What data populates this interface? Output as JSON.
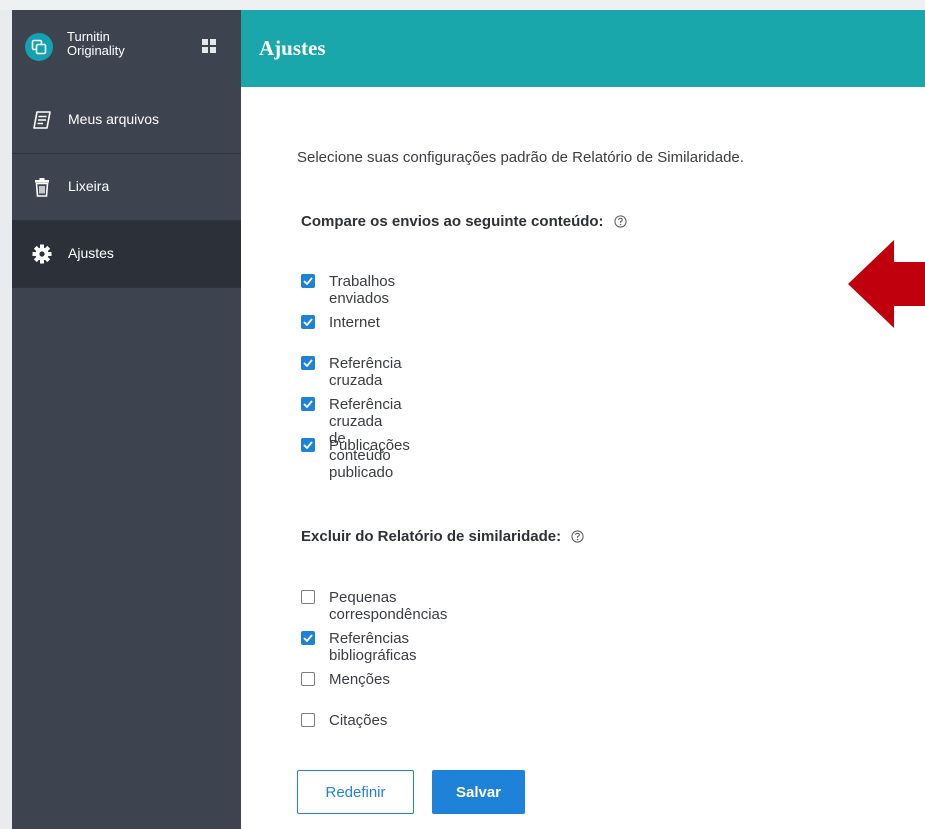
{
  "brand": {
    "line1": "Turnitin",
    "line2": "Originality"
  },
  "sidebar": {
    "items": [
      {
        "label": "Meus arquivos",
        "icon": "file-list-icon"
      },
      {
        "label": "Lixeira",
        "icon": "trash-icon"
      },
      {
        "label": "Ajustes",
        "icon": "gear-icon",
        "active": true
      }
    ]
  },
  "header": {
    "title": "Ajustes"
  },
  "main": {
    "intro": "Selecione suas configurações padrão de Relatório de Similaridade.",
    "compare": {
      "title": "Compare os envios ao seguinte conteúdo:",
      "options": [
        {
          "label": "Trabalhos enviados",
          "checked": true
        },
        {
          "label": "Internet",
          "checked": true
        },
        {
          "label": "Referência cruzada",
          "checked": true
        },
        {
          "label": "Referência cruzada de conteúdo publicado",
          "checked": true
        },
        {
          "label": "Publicações",
          "checked": true
        }
      ]
    },
    "exclude": {
      "title": "Excluir do Relatório de similaridade:",
      "options": [
        {
          "label": "Pequenas correspondências",
          "checked": false
        },
        {
          "label": "Referências bibliográficas",
          "checked": true
        },
        {
          "label": "Menções",
          "checked": false
        },
        {
          "label": "Citações",
          "checked": false
        }
      ]
    },
    "buttons": {
      "reset": "Redefinir",
      "save": "Salvar"
    }
  },
  "colors": {
    "sidebar": "#3e4350",
    "sidebar_active": "#2c3039",
    "header": "#1aa7ac",
    "accent": "#1f82d9",
    "annotation_arrow": "#c0000c"
  }
}
